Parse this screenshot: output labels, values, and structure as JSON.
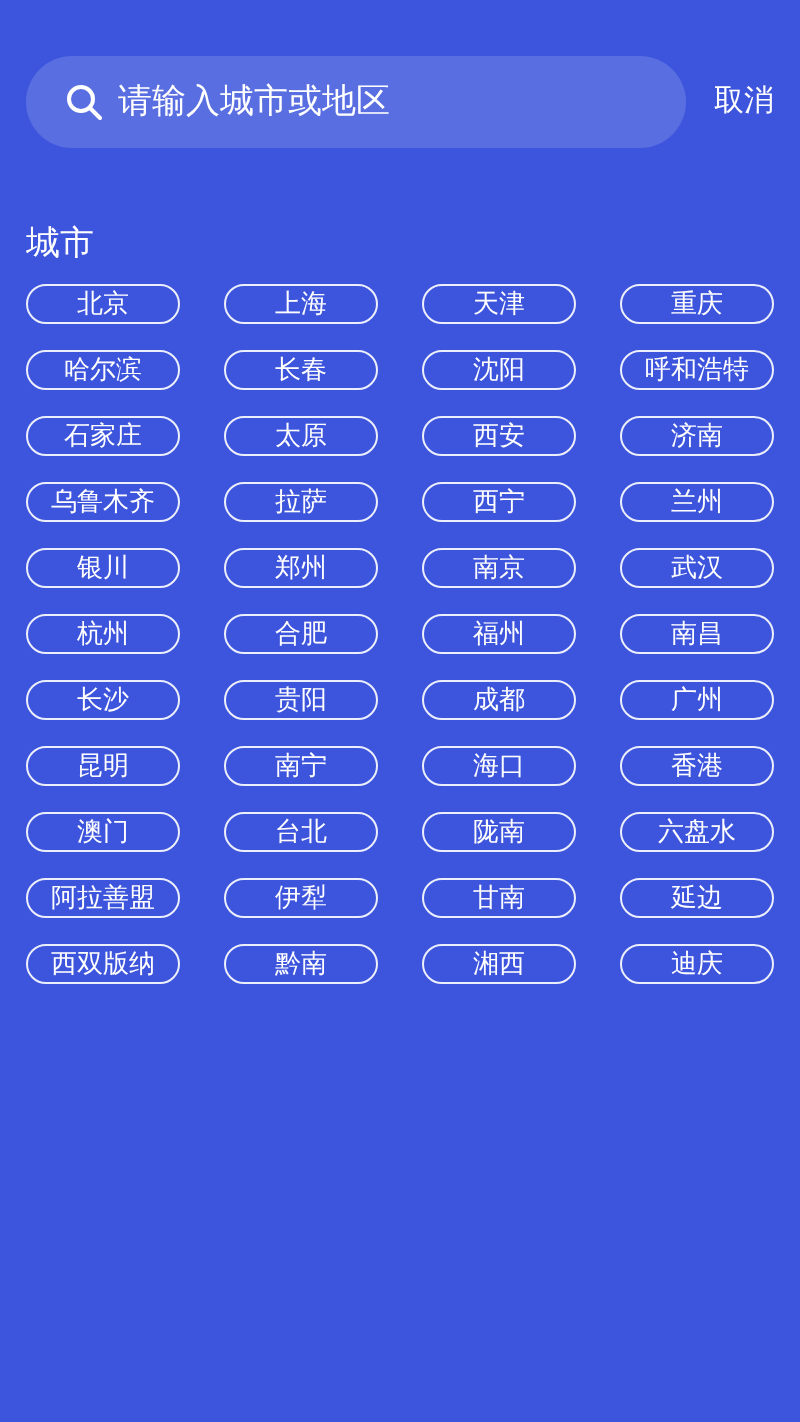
{
  "search": {
    "placeholder": "请输入城市或地区"
  },
  "cancel": "取消",
  "section_title": "城市",
  "cities": [
    "北京",
    "上海",
    "天津",
    "重庆",
    "哈尔滨",
    "长春",
    "沈阳",
    "呼和浩特",
    "石家庄",
    "太原",
    "西安",
    "济南",
    "乌鲁木齐",
    "拉萨",
    "西宁",
    "兰州",
    "银川",
    "郑州",
    "南京",
    "武汉",
    "杭州",
    "合肥",
    "福州",
    "南昌",
    "长沙",
    "贵阳",
    "成都",
    "广州",
    "昆明",
    "南宁",
    "海口",
    "香港",
    "澳门",
    "台北",
    "陇南",
    "六盘水",
    "阿拉善盟",
    "伊犁",
    "甘南",
    "延边",
    "西双版纳",
    "黔南",
    "湘西",
    "迪庆"
  ]
}
